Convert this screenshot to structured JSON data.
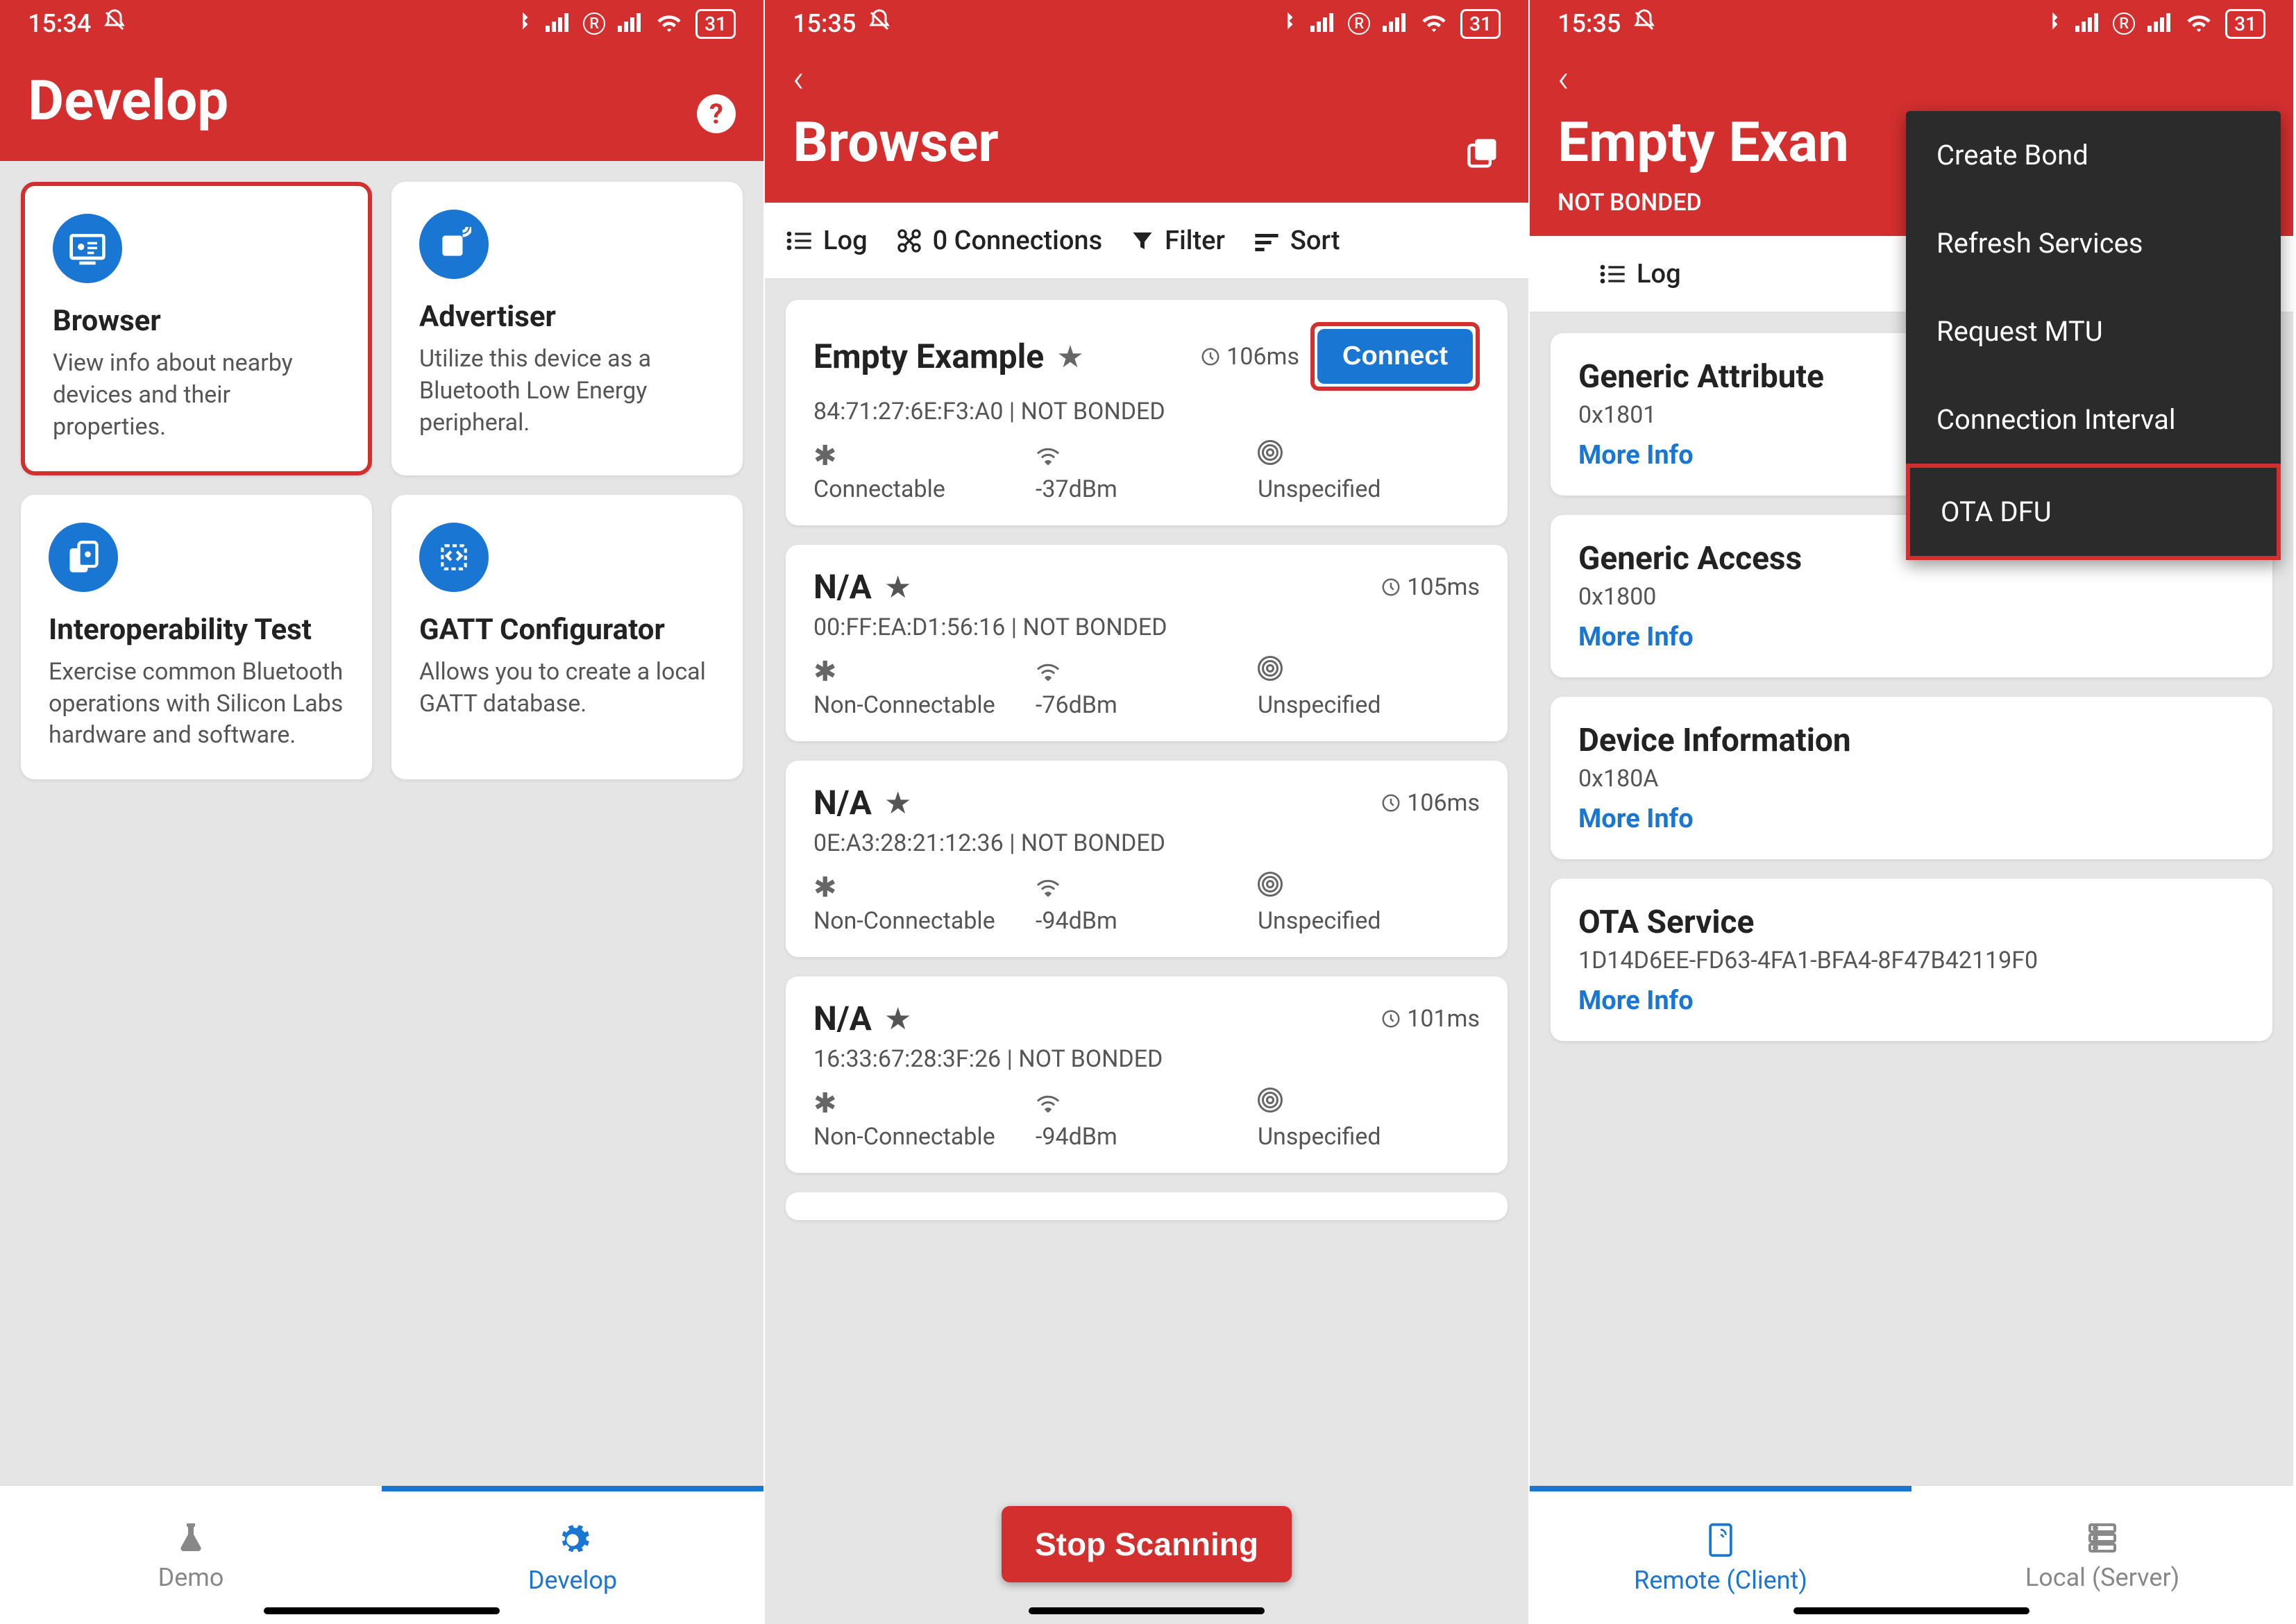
{
  "status": {
    "time1": "15:34",
    "time2": "15:35",
    "time3": "15:35",
    "battery": "31"
  },
  "screen1": {
    "title": "Develop",
    "cards": [
      {
        "title": "Browser",
        "desc": "View info about nearby devices and their properties.",
        "highlight": true
      },
      {
        "title": "Advertiser",
        "desc": "Utilize this device as a Bluetooth Low Energy peripheral."
      },
      {
        "title": "Interoperability Test",
        "desc": "Exercise common Bluetooth operations with Silicon Labs hardware and software."
      },
      {
        "title": "GATT Configurator",
        "desc": "Allows you to create a local GATT database."
      }
    ],
    "nav": {
      "demo": "Demo",
      "develop": "Develop"
    }
  },
  "screen2": {
    "title": "Browser",
    "toolbar": {
      "log": "Log",
      "conn": "0 Connections",
      "filter": "Filter",
      "sort": "Sort"
    },
    "devices": [
      {
        "name": "Empty Example",
        "starred": false,
        "time": "106ms",
        "mac": "84:71:27:6E:F3:A0 | NOT BONDED",
        "conn": "Connectable",
        "rssi": "-37dBm",
        "adv": "Unspecified",
        "connectbtn": "Connect",
        "highlight": true
      },
      {
        "name": "N/A",
        "starred": true,
        "time": "105ms",
        "mac": "00:FF:EA:D1:56:16 | NOT BONDED",
        "conn": "Non-Connectable",
        "rssi": "-76dBm",
        "adv": "Unspecified"
      },
      {
        "name": "N/A",
        "starred": true,
        "time": "106ms",
        "mac": "0E:A3:28:21:12:36 | NOT BONDED",
        "conn": "Non-Connectable",
        "rssi": "-94dBm",
        "adv": "Unspecified"
      },
      {
        "name": "N/A",
        "starred": true,
        "time": "101ms",
        "mac": "16:33:67:28:3F:26 | NOT BONDED",
        "conn": "Non-Connectable",
        "rssi": "-94dBm",
        "adv": "Unspecified"
      }
    ],
    "stop": "Stop Scanning"
  },
  "screen3": {
    "title": "Empty Exan",
    "bond": "NOT BONDED",
    "log": "Log",
    "services": [
      {
        "name": "Generic Attribute",
        "uuid": "0x1801"
      },
      {
        "name": "Generic Access",
        "uuid": "0x1800"
      },
      {
        "name": "Device Information",
        "uuid": "0x180A"
      },
      {
        "name": "OTA Service",
        "uuid": "1D14D6EE-FD63-4FA1-BFA4-8F47B42119F0"
      }
    ],
    "more": "More Info",
    "menu": [
      {
        "label": "Create Bond"
      },
      {
        "label": "Refresh Services"
      },
      {
        "label": "Request MTU"
      },
      {
        "label": "Connection Interval"
      },
      {
        "label": "OTA DFU",
        "highlight": true
      }
    ],
    "nav": {
      "remote": "Remote (Client)",
      "local": "Local (Server)"
    }
  }
}
